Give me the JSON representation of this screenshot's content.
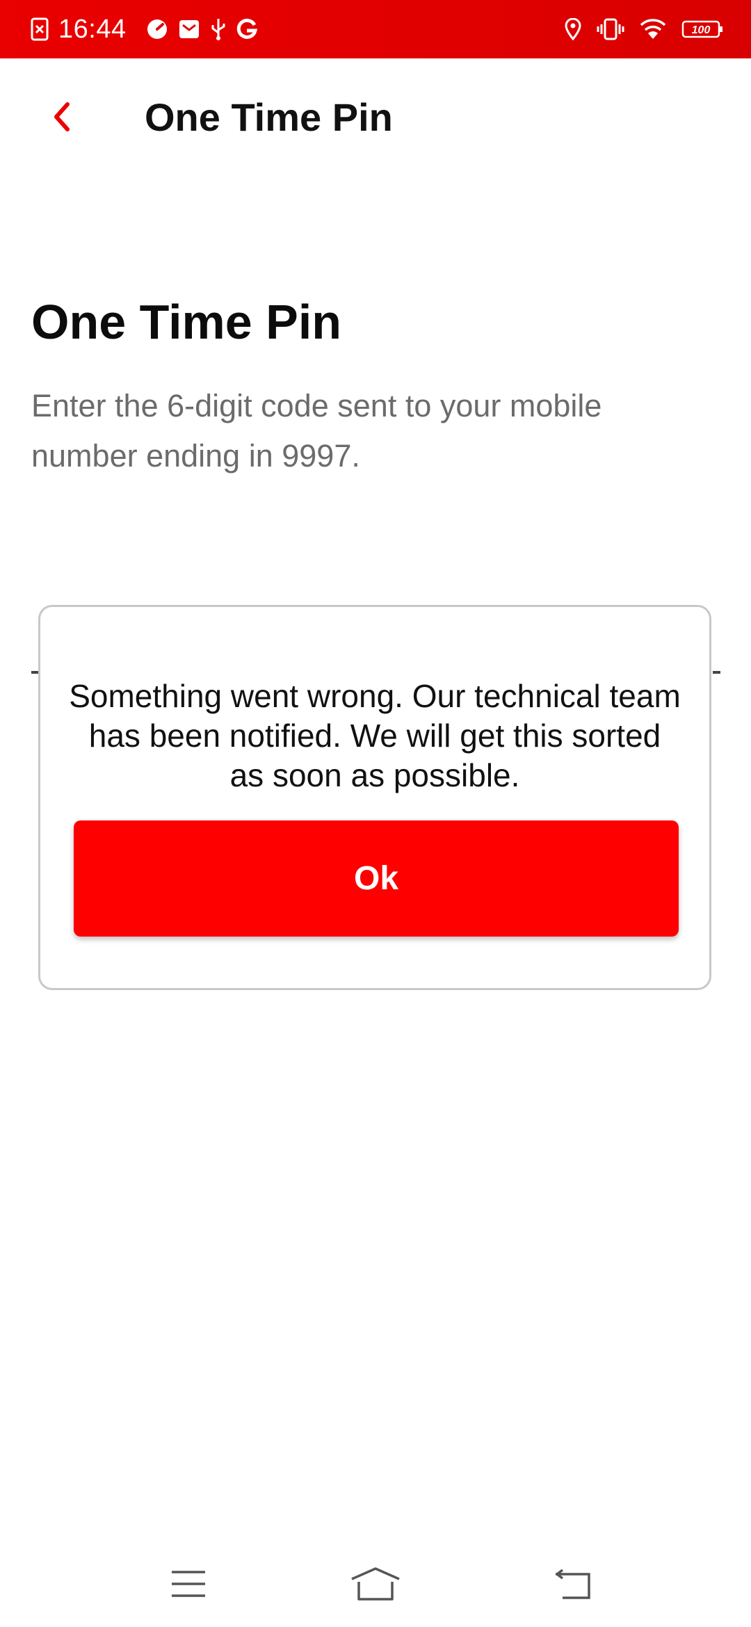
{
  "status_bar": {
    "time": "16:44",
    "battery": "100",
    "left_icons": [
      "screenshot-icon",
      "speedometer-icon",
      "mail-icon",
      "usb-icon",
      "google-icon"
    ],
    "right_icons": [
      "location-icon",
      "vibrate-icon",
      "wifi-icon",
      "battery-icon"
    ]
  },
  "header": {
    "back_icon": "chevron-left-icon",
    "title": "One Time Pin"
  },
  "main": {
    "title": "One Time Pin",
    "description": "Enter the 6-digit code sent to your mobile number ending in 9997."
  },
  "dialog": {
    "message": "Something went wrong. Our technical team has been notified. We will get this sorted as soon as possible.",
    "ok_label": "Ok"
  },
  "nav_bar": {
    "items": [
      "menu-icon",
      "home-icon",
      "back-icon"
    ]
  },
  "colors": {
    "brand_red": "#ff0000",
    "status_bar_red": "#e60000",
    "title_text": "#111111",
    "body_text": "#6b6b6b"
  }
}
